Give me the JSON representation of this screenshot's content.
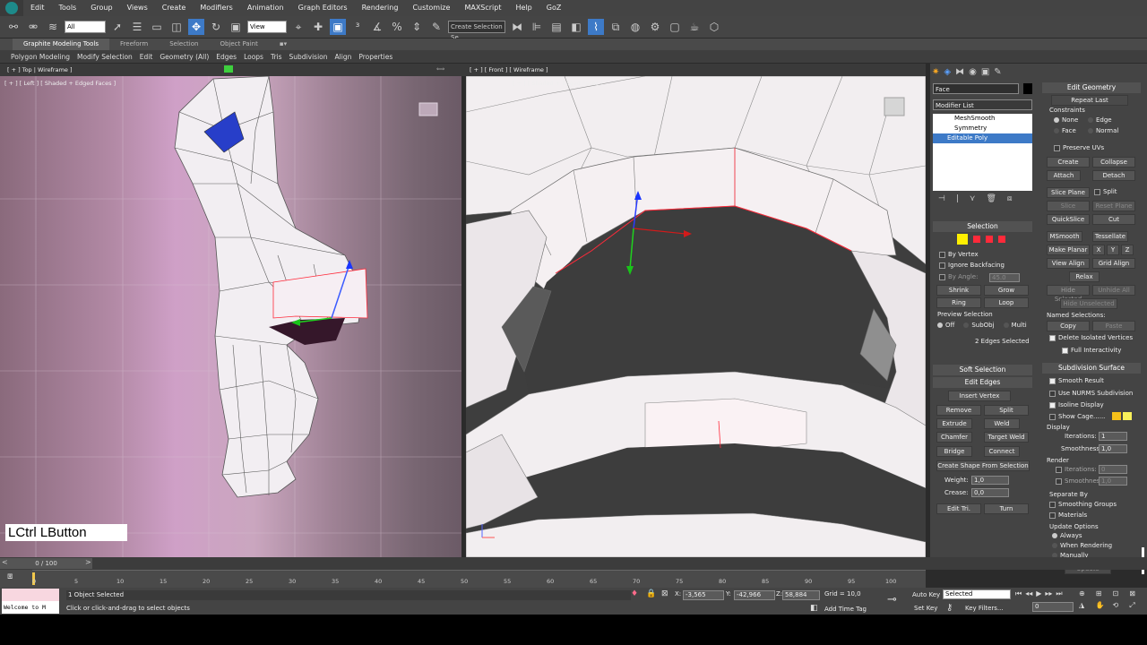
{
  "menu": [
    "Edit",
    "Tools",
    "Group",
    "Views",
    "Create",
    "Modifiers",
    "Animation",
    "Graph Editors",
    "Rendering",
    "Customize",
    "MAXScript",
    "Help",
    "GoZ"
  ],
  "toolbar": {
    "filter_select": "All",
    "view_select": "View",
    "selection_set": "Create Selection Se"
  },
  "ribbon": {
    "tabs": [
      "Graphite Modeling Tools",
      "Freeform",
      "Selection",
      "Object Paint"
    ],
    "sub": [
      "Polygon Modeling",
      "Modify Selection",
      "Edit",
      "Geometry (All)",
      "Edges",
      "Loops",
      "Tris",
      "Subdivision",
      "Align",
      "Properties"
    ]
  },
  "viewports": {
    "top_label": "[ + ] Top | Wireframe ]",
    "left_label": "[ + ] [ Left ] [ Shaded + Edged Faces ]",
    "front_label": "[ + ] [ Front ] [ Wireframe ]",
    "front_ghost_label": "[ + ] [ Shaded + Edged Faces ]",
    "keystroke": "LCtrl LButton"
  },
  "command_panel": {
    "object_name": "Face",
    "modifier_list": "Modifier List",
    "stack": [
      "MeshSmooth",
      "Symmetry",
      "Editable Poly"
    ],
    "selection": {
      "title": "Selection",
      "by_vertex": "By Vertex",
      "ignore_backfacing": "Ignore Backfacing",
      "by_angle": "By Angle:",
      "angle_value": "45.0",
      "shrink": "Shrink",
      "grow": "Grow",
      "ring": "Ring",
      "loop": "Loop",
      "preview": "Preview Selection",
      "preview_opts": [
        "Off",
        "SubObj",
        "Multi"
      ],
      "status": "2 Edges Selected"
    },
    "soft_selection": "Soft Selection",
    "edit_edges": {
      "title": "Edit Edges",
      "insert_vertex": "Insert Vertex",
      "remove": "Remove",
      "split": "Split",
      "extrude": "Extrude",
      "weld": "Weld",
      "chamfer": "Chamfer",
      "target_weld": "Target Weld",
      "bridge": "Bridge",
      "connect": "Connect",
      "create_shape": "Create Shape From Selection",
      "weight_label": "Weight:",
      "weight": "1,0",
      "crease_label": "Crease:",
      "crease": "0,0",
      "edit_tri": "Edit Tri.",
      "turn": "Turn"
    },
    "edit_geometry": {
      "title": "Edit Geometry",
      "repeat_last": "Repeat Last",
      "constraints": "Constraints",
      "constraint_opts": [
        "None",
        "Edge",
        "Face",
        "Normal"
      ],
      "preserve_uvs": "Preserve UVs",
      "create": "Create",
      "collapse": "Collapse",
      "attach": "Attach",
      "detach": "Detach",
      "slice_plane": "Slice Plane",
      "split": "Split",
      "slice": "Slice",
      "reset_plane": "Reset Plane",
      "quickslice": "QuickSlice",
      "cut": "Cut",
      "msmooth": "MSmooth",
      "tessellate": "Tessellate",
      "make_planar": "Make Planar",
      "x": "X",
      "y": "Y",
      "z": "Z",
      "view_align": "View Align",
      "grid_align": "Grid Align",
      "relax": "Relax",
      "hide_selected": "Hide Selected",
      "unhide_all": "Unhide All",
      "hide_unselected": "Hide Unselected",
      "named_selections": "Named Selections:",
      "copy": "Copy",
      "paste": "Paste",
      "delete_isolated": "Delete Isolated Vertices",
      "full_interactivity": "Full Interactivity"
    },
    "subdivision_surface": {
      "title": "Subdivision Surface",
      "smooth_result": "Smooth Result",
      "use_nurms": "Use NURMS Subdivision",
      "isoline": "Isoline Display",
      "show_cage": "Show Cage......",
      "display": "Display",
      "iterations_label": "Iterations:",
      "iterations": "1",
      "smoothness_label": "Smoothness:",
      "smoothness": "1,0",
      "render": "Render",
      "r_iterations": "0",
      "r_smoothness": "1,0",
      "separate_by": "Separate By",
      "smoothing_groups": "Smoothing Groups",
      "materials": "Materials",
      "update_options": "Update Options",
      "update_opts": [
        "Always",
        "When Rendering",
        "Manually"
      ],
      "update": "Update"
    }
  },
  "timeline": {
    "frame": "0 / 100",
    "ticks": [
      "0",
      "5",
      "10",
      "15",
      "20",
      "25",
      "30",
      "35",
      "40",
      "45",
      "50",
      "55",
      "60",
      "65",
      "70",
      "75",
      "80",
      "85",
      "90",
      "95",
      "100"
    ]
  },
  "status": {
    "maxscript": "Welcome to M",
    "objects": "1 Object Selected",
    "prompt": "Click or click-and-drag to select objects",
    "x": "-3,565",
    "y": "-42,966",
    "z": "58,884",
    "grid": "Grid = 10,0",
    "add_time_tag": "Add Time Tag",
    "auto_key": "Auto Key",
    "selected": "Selected",
    "set_key": "Set Key",
    "key_filters": "Key Filters...",
    "frame_field": "0"
  },
  "colors": {
    "accent": "#3d7ac7",
    "selection_red": "#ff2a3a",
    "yellow": "#ffef00"
  }
}
